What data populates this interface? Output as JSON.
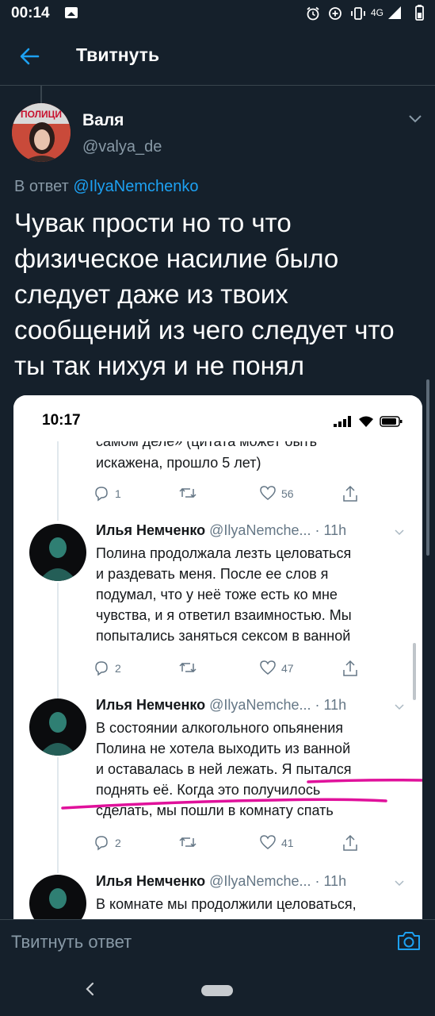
{
  "status_bar": {
    "time": "00:14",
    "network": "4G"
  },
  "header": {
    "title": "Твитнуть"
  },
  "tweet": {
    "author_name": "Валя",
    "author_handle": "@valya_de",
    "avatar_sign": "ПОЛИЦИ",
    "reply_prefix": "В ответ",
    "reply_mention": "@IlyaNemchenko",
    "text": "Чувак прости но то что физическое насилие было следует даже из твоих сообщений из чего следует что ты так нихуя и не понял"
  },
  "embedded_screenshot": {
    "time": "10:17",
    "top_tweet": {
      "cut_line": "самом деле» (цитата может быть",
      "line": "искажена, прошло 5 лет)",
      "replies": "1",
      "likes": "56"
    },
    "tweets": [
      {
        "name": "Илья Немченко",
        "handle_time": "@IlyaNemche... · 11h",
        "lines": [
          "Полина продолжала лезть целоваться",
          "и раздевать меня. После ее слов я",
          "подумал, что у неё тоже есть ко мне",
          "чувства, и я ответил взаимностью. Мы",
          "попытались заняться сексом в ванной"
        ],
        "replies": "2",
        "likes": "47"
      },
      {
        "name": "Илья Немченко",
        "handle_time": "@IlyaNemche... · 11h",
        "lines": [
          "В состоянии алкогольного опьянения",
          "Полина не хотела выходить из ванной",
          "и оставалась в ней лежать. Я пытался",
          "поднять её. Когда это получилось",
          "сделать, мы пошли в комнату спать"
        ],
        "replies": "2",
        "likes": "41"
      },
      {
        "name": "Илья Немченко",
        "handle_time": "@IlyaNemche... · 11h",
        "lines": [
          "В комнате мы продолжили целоваться,"
        ]
      }
    ],
    "highlight_color": "#e0119b"
  },
  "compose": {
    "placeholder": "Твитнуть ответ"
  },
  "colors": {
    "background": "#15202b",
    "accent": "#1da1f2",
    "muted": "#8899a6",
    "divider": "#38444d"
  }
}
